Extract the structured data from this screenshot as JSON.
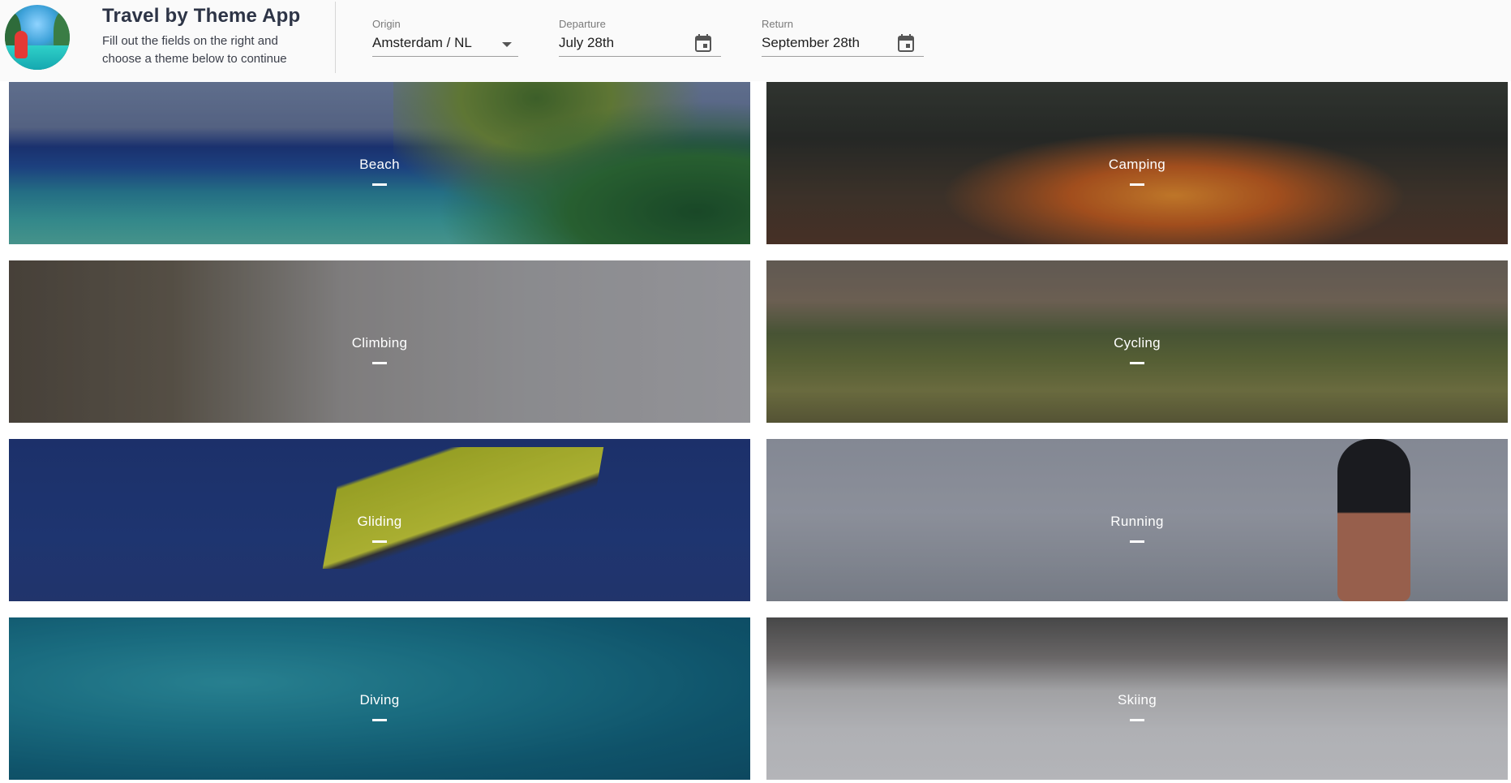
{
  "header": {
    "title": "Travel by Theme App",
    "subtitle": "Fill out the fields on the right and choose a theme below to continue",
    "origin": {
      "label": "Origin",
      "value": "Amsterdam / NL",
      "icon": "dropdown-arrow-icon"
    },
    "departure": {
      "label": "Departure",
      "value": "July 28th",
      "icon": "calendar-icon"
    },
    "return": {
      "label": "Return",
      "value": "September 28th",
      "icon": "calendar-icon"
    }
  },
  "themes": [
    {
      "label": "Beach"
    },
    {
      "label": "Camping"
    },
    {
      "label": "Climbing"
    },
    {
      "label": "Cycling"
    },
    {
      "label": "Gliding"
    },
    {
      "label": "Running"
    },
    {
      "label": "Diving"
    },
    {
      "label": "Skiing"
    }
  ]
}
